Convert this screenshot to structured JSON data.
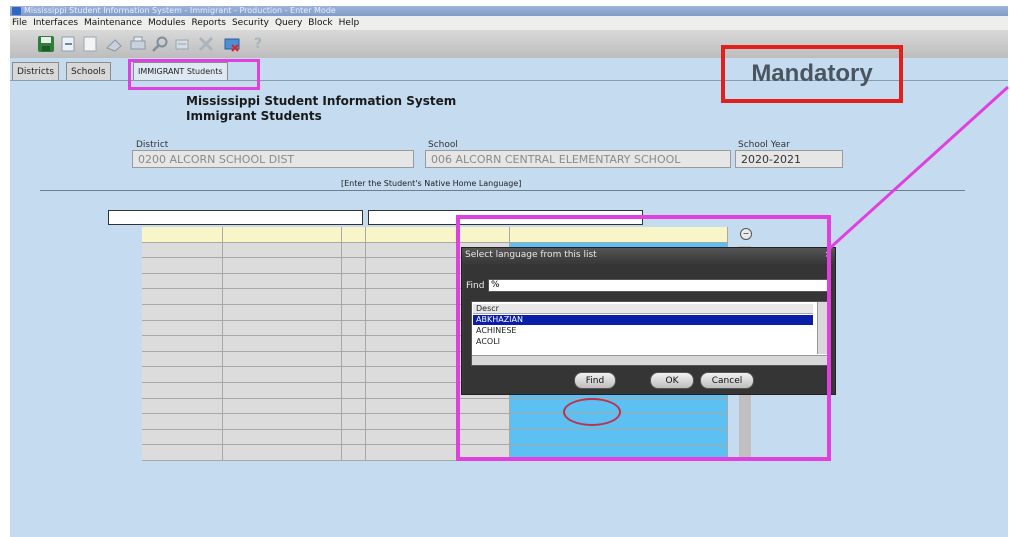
{
  "window": {
    "title": "Mississippi Student Information System - Immigrant - Production - Enter Mode"
  },
  "menu": [
    "File",
    "Interfaces",
    "Maintenance",
    "Modules",
    "Reports",
    "Security",
    "Query",
    "Block",
    "Help"
  ],
  "toolbar": {
    "icons": [
      "save-icon",
      "exit-icon",
      "new-record-icon",
      "erase-icon",
      "print-icon",
      "search-icon",
      "clear-icon",
      "delete-icon",
      "edit-icon",
      "help-icon"
    ]
  },
  "tabs": [
    "Districts",
    "Schools",
    "IMMIGRANT Students"
  ],
  "header": {
    "system_title": "Mississippi Student Information System",
    "module_title": "Immigrant Students"
  },
  "annotation": {
    "mandatory_label": "Mandatory"
  },
  "fields": {
    "district_label": "District",
    "district_value": "0200  ALCORN SCHOOL DIST",
    "school_label": "School",
    "school_value": "006  ALCORN CENTRAL ELEMENTARY SCHOOL",
    "school_year_label": "School Year",
    "school_year_value": "2020-2021"
  },
  "hint": "[Enter the Student's Native Home Language]",
  "dialog": {
    "title": "Select language from this list",
    "find_label": "Find",
    "find_value": "%",
    "list_header": "Descr",
    "items": [
      "ABKHAZIAN",
      "ACHINESE",
      "ACOLI"
    ],
    "selected_item": "ABKHAZIAN",
    "buttons": {
      "find": "Find",
      "ok": "OK",
      "cancel": "Cancel"
    }
  },
  "colors": {
    "highlight_magenta": "#e040e0",
    "mandatory_red": "#e0201c",
    "workspace_bg": "#c5dcf0",
    "selected_row": "#0a1ea8",
    "language_column": "#5cc1f2"
  }
}
